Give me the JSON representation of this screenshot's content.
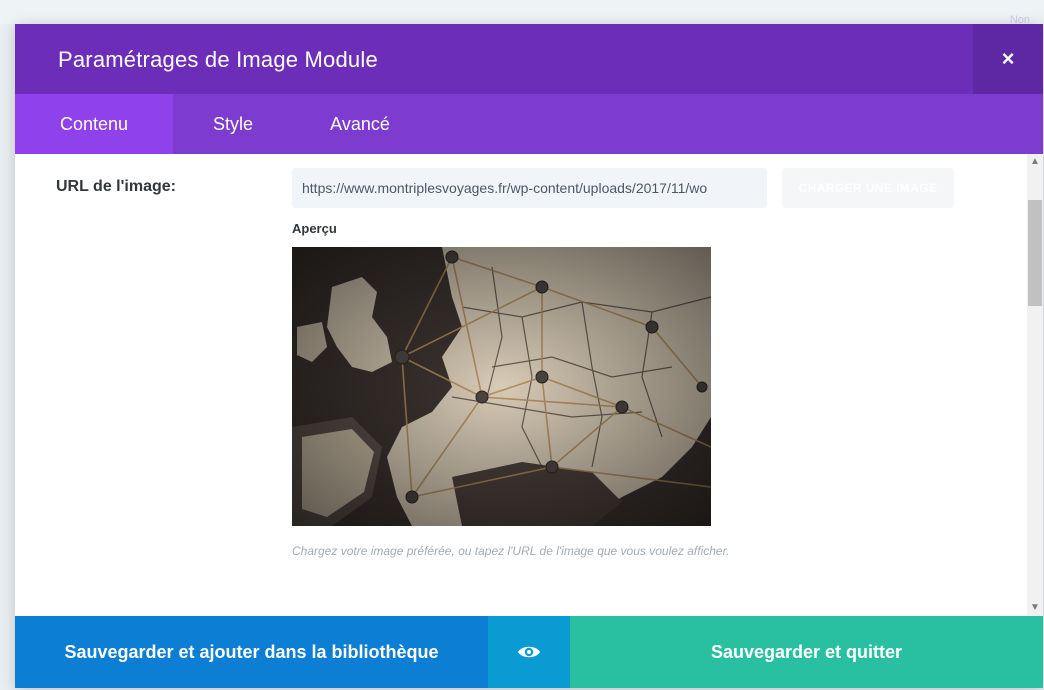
{
  "backdrop": {
    "corner_text": "Non"
  },
  "modal": {
    "title": "Paramétrages de Image Module",
    "close_symbol": "×",
    "tabs": [
      {
        "label": "Contenu",
        "active": true
      },
      {
        "label": "Style",
        "active": false
      },
      {
        "label": "Avancé",
        "active": false
      }
    ],
    "image_field": {
      "label": "URL de l'image:",
      "value": "https://www.montriplesvoyages.fr/wp-content/uploads/2017/11/wo",
      "upload_button_label": "CHARGER UNE IMAGE",
      "preview_label": "Aperçu",
      "description": "Chargez votre image préférée, ou tapez l'URL de l'image que vous voulez afficher."
    },
    "footer": {
      "save_library_label": "Sauvegarder et ajouter dans la bibliothèque",
      "preview_icon": "eye-icon",
      "save_quit_label": "Sauvegarder et quitter"
    },
    "colors": {
      "header": "#6c2eb9",
      "tabs": "#7e3bd0",
      "active_tab": "#8f42ec",
      "save_library": "#0c7ed4",
      "preview": "#0a9bd3",
      "save_quit": "#28c0a0"
    }
  }
}
